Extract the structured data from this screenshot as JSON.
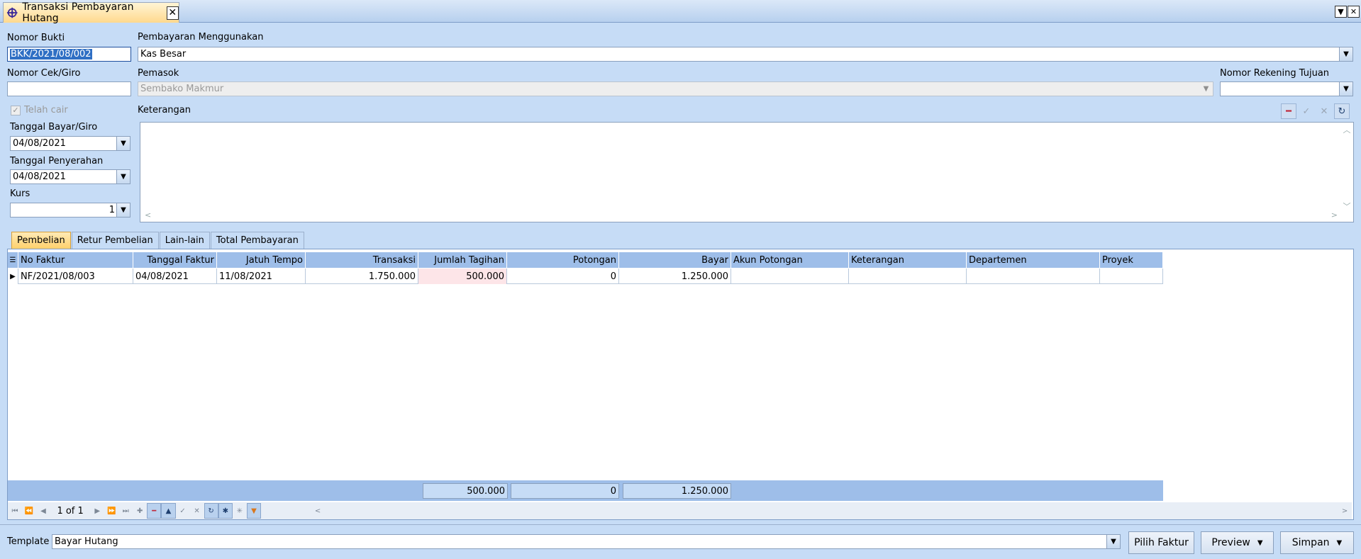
{
  "window": {
    "tab_title": "Transaksi Pembayaran Hutang"
  },
  "header": {
    "nomor_bukti": {
      "label": "Nomor Bukti",
      "value": "BKK/2021/08/002"
    },
    "pembayaran": {
      "label": "Pembayaran Menggunakan",
      "value": "Kas Besar"
    },
    "nomor_cek": {
      "label": "Nomor Cek/Giro",
      "value": ""
    },
    "pemasok": {
      "label": "Pemasok",
      "value": "Sembako Makmur"
    },
    "rekening": {
      "label": "Nomor Rekening Tujuan",
      "value": ""
    },
    "telah_cair": {
      "label": "Telah cair",
      "checked": true
    },
    "keterangan": {
      "label": "Keterangan",
      "value": ""
    },
    "tanggal_bayar": {
      "label": "Tanggal Bayar/Giro",
      "value": "04/08/2021"
    },
    "tanggal_penyerahan": {
      "label": "Tanggal Penyerahan",
      "value": "04/08/2021"
    },
    "kurs": {
      "label": "Kurs",
      "value": "1"
    }
  },
  "tabs": [
    "Pembelian",
    "Retur Pembelian",
    "Lain-lain",
    "Total Pembayaran"
  ],
  "grid": {
    "columns": [
      "No Faktur",
      "Tanggal Faktur",
      "Jatuh Tempo",
      "Transaksi",
      "Jumlah Tagihan",
      "Potongan",
      "Bayar",
      "Akun Potongan",
      "Keterangan",
      "Departemen",
      "Proyek"
    ],
    "rows": [
      [
        "NF/2021/08/003",
        "04/08/2021",
        "11/08/2021",
        "1.750.000",
        "500.000",
        "0",
        "1.250.000",
        "",
        "",
        "",
        ""
      ]
    ],
    "totals": {
      "jumlah_tagihan": "500.000",
      "potongan": "0",
      "bayar": "1.250.000"
    }
  },
  "navigator": {
    "page": "1 of 1"
  },
  "footer": {
    "template_label": "Template",
    "template_value": "Bayar Hutang",
    "pilih_faktur": "Pilih Faktur",
    "preview": "Preview",
    "simpan": "Simpan"
  },
  "colors": {
    "accent": "#9ebee9",
    "tab_active": "#ffd98d",
    "background": "#c6dcf6",
    "highlight_cell": "#fde5e8"
  }
}
